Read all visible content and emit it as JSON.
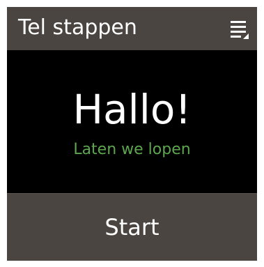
{
  "header": {
    "title": "Tel stappen",
    "menu_icon": "menu-icon"
  },
  "main": {
    "greeting": "Hallo!",
    "subtitle": "Laten we lopen"
  },
  "footer": {
    "start_label": "Start"
  },
  "colors": {
    "bar_background": "#4a4540",
    "screen_background": "#000000",
    "accent_green": "#5da54e",
    "text_primary": "#ffffff"
  }
}
